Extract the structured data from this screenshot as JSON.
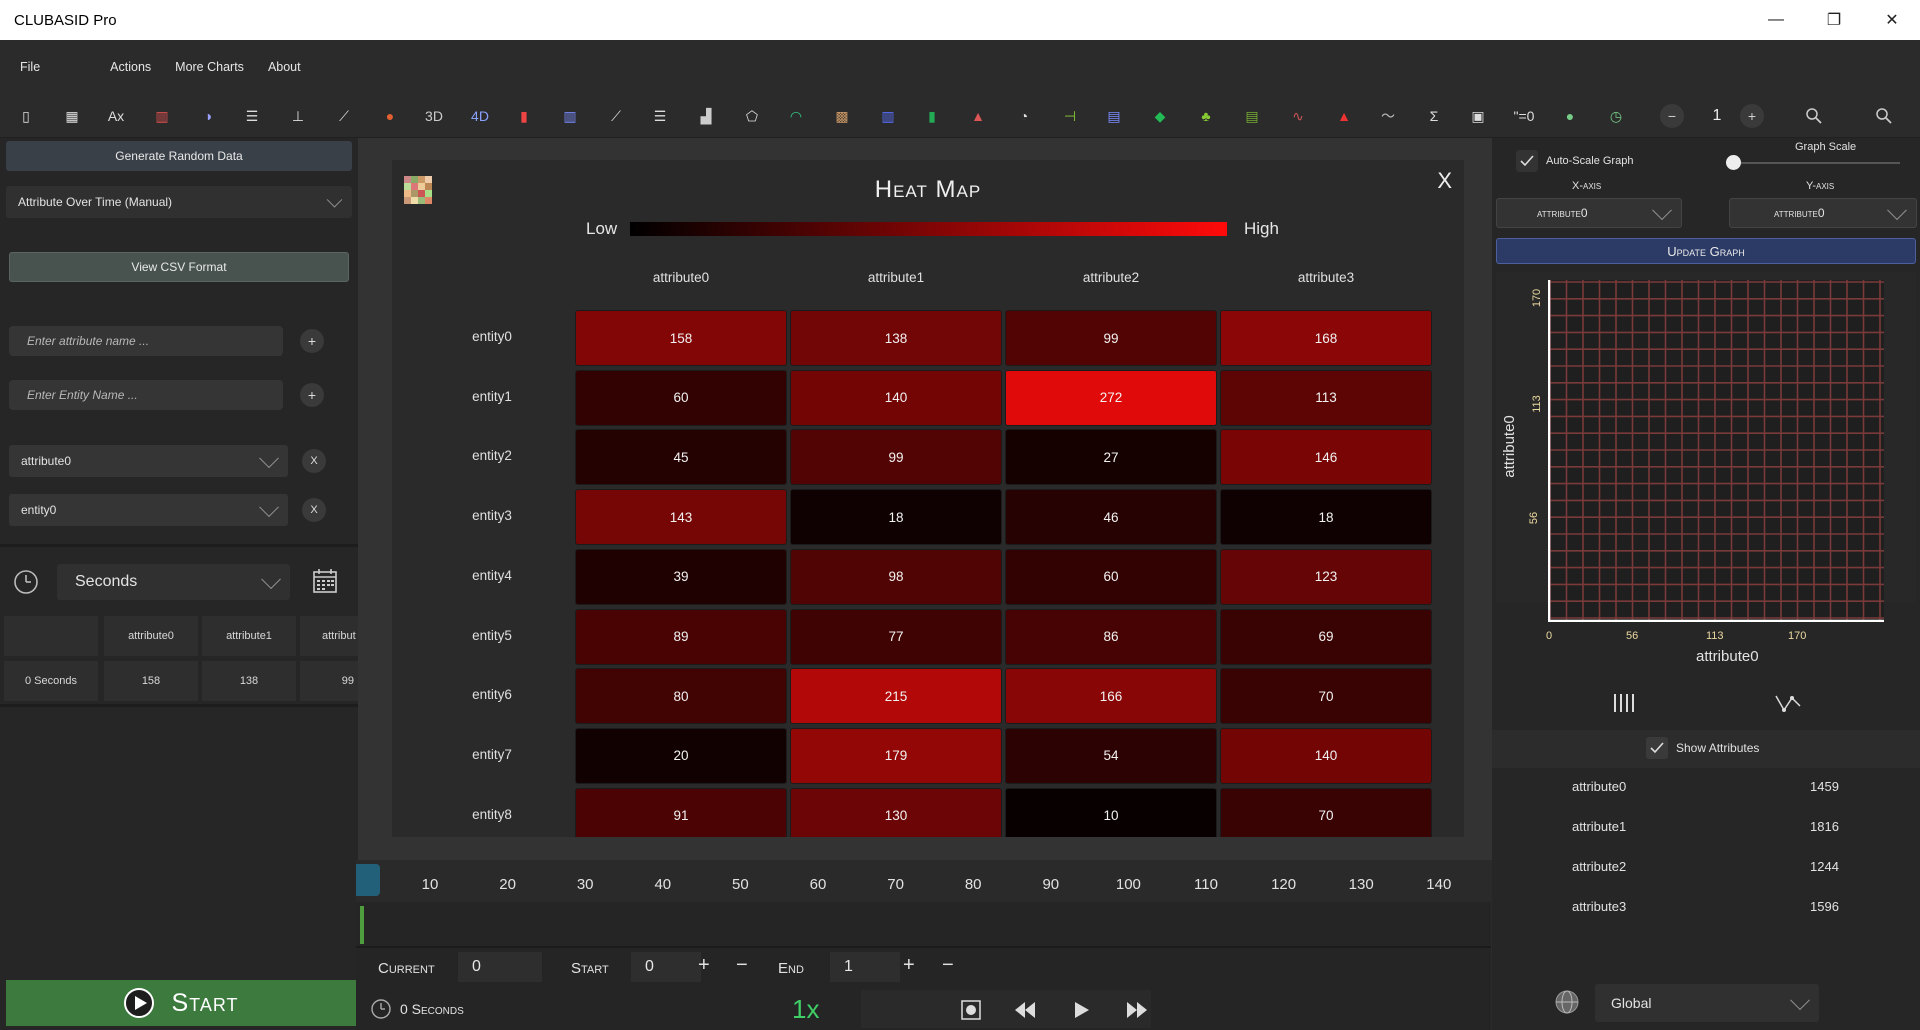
{
  "window": {
    "title": "CLUBASID Pro",
    "minimize": "—",
    "restore": "❐",
    "close": "✕"
  },
  "menu": [
    "File",
    "Actions",
    "More Charts",
    "About"
  ],
  "toolbar": {
    "icons": [
      "new-file-icon",
      "grid-icon",
      "attribute-x-icon",
      "bar-chart-icon",
      "pie-chart-icon",
      "horizontal-bar-icon",
      "histogram-icon",
      "line-chart-icon",
      "bubble-chart-icon",
      "3d-chart-icon",
      "4d-chart-icon",
      "stacked-bar-icon",
      "column-chart-icon",
      "scatter-icon",
      "multi-line-icon",
      "area-bars-icon",
      "radar-icon",
      "arc-icon",
      "heatmap-icon",
      "candlestick-icon",
      "green-bars-icon",
      "pyramid-icon",
      "donut-icon",
      "timeline-icon",
      "map-gradient-icon",
      "up-down-icon",
      "africa-map-icon",
      "green-table-icon",
      "sparkline-icon",
      "warning-icon",
      "wave-icon",
      "sigma-icon",
      "image-icon",
      "equation-icon",
      "globe-color-icon",
      "clock-icon"
    ],
    "text_3d": "3D",
    "text_4d": "4D",
    "text_eq": "\"=0",
    "zoom_value": "1"
  },
  "left": {
    "generate_label": "Generate Random Data",
    "mode_dropdown": "Attribute Over Time (Manual)",
    "view_csv_label": "View CSV Format",
    "attr_placeholder": "Enter attribute name ...",
    "entity_placeholder": "Enter Entity Name ...",
    "attr_select": "attribute0",
    "entity_select": "entity0",
    "remove_label": "X",
    "add_label": "+",
    "time_unit": "Seconds",
    "table": {
      "headers": [
        "",
        "attribute0",
        "attribute1",
        "attribut"
      ],
      "rows": [
        [
          "0 Seconds",
          "158",
          "138",
          "99"
        ]
      ]
    },
    "start_label": "Start"
  },
  "heatmap": {
    "title": "Heat Map",
    "close_label": "X",
    "legend_low": "Low",
    "legend_high": "High",
    "columns": [
      "attribute0",
      "attribute1",
      "attribute2",
      "attribute3"
    ],
    "rows": [
      "entity0",
      "entity1",
      "entity2",
      "entity3",
      "entity4",
      "entity5",
      "entity6",
      "entity7",
      "entity8"
    ],
    "colors": {
      "low": "#000000",
      "high": "#ff0a0a"
    }
  },
  "chart_data": {
    "type": "heatmap",
    "title": "Heat Map",
    "x": [
      "attribute0",
      "attribute1",
      "attribute2",
      "attribute3"
    ],
    "y": [
      "entity0",
      "entity1",
      "entity2",
      "entity3",
      "entity4",
      "entity5",
      "entity6",
      "entity7",
      "entity8"
    ],
    "values": [
      [
        158,
        138,
        99,
        168
      ],
      [
        60,
        140,
        272,
        113
      ],
      [
        45,
        99,
        27,
        146
      ],
      [
        143,
        18,
        46,
        18
      ],
      [
        39,
        98,
        60,
        123
      ],
      [
        89,
        77,
        86,
        69
      ],
      [
        80,
        215,
        166,
        70
      ],
      [
        20,
        179,
        54,
        140
      ],
      [
        91,
        130,
        10,
        70
      ]
    ],
    "legend": {
      "low": "Low",
      "high": "High"
    }
  },
  "timeline": {
    "ticks": [
      "10",
      "20",
      "30",
      "40",
      "50",
      "60",
      "70",
      "80",
      "90",
      "100",
      "110",
      "120",
      "130",
      "140"
    ],
    "current_label": "Current",
    "current_value": "0",
    "start_label": "Start",
    "start_value": "0",
    "end_label": "End",
    "end_value": "1",
    "plus": "+",
    "minus": "−",
    "elapsed": "0 Seconds",
    "speed": "1x"
  },
  "right": {
    "auto_scale_label": "Auto-Scale Graph",
    "graph_scale_label": "Graph Scale",
    "x_axis_label": "X-axis",
    "y_axis_label": "Y-axis",
    "x_axis_value": "attribute0",
    "y_axis_value": "attribute0",
    "update_label": "Update Graph",
    "mini_chart": {
      "x_ticks": [
        "0",
        "56",
        "113",
        "170"
      ],
      "y_ticks": [
        "170",
        "113",
        "56"
      ],
      "xlabel": "attribute0",
      "ylabel": "attribute0"
    },
    "show_attributes_label": "Show Attributes",
    "attributes": [
      {
        "name": "attribute0",
        "value": "1459"
      },
      {
        "name": "attribute1",
        "value": "1816"
      },
      {
        "name": "attribute2",
        "value": "1244"
      },
      {
        "name": "attribute3",
        "value": "1596"
      }
    ],
    "scope": "Global"
  }
}
